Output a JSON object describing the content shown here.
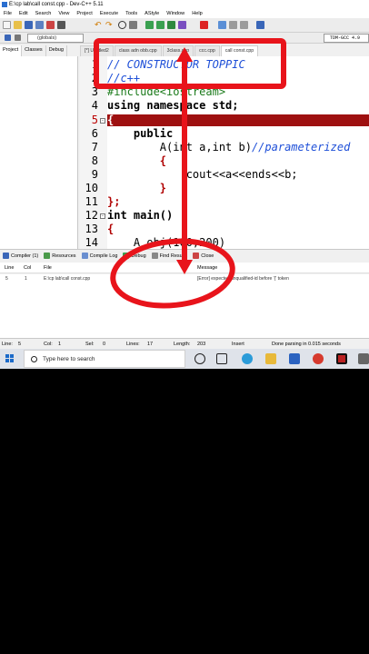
{
  "window": {
    "title": "E:\\cp lab\\call const.cpp - Dev-C++ 5.11"
  },
  "menu": [
    "File",
    "Edit",
    "Search",
    "View",
    "Project",
    "Execute",
    "Tools",
    "AStyle",
    "Window",
    "Help"
  ],
  "toolbar": {
    "scope_combo": "(globals)",
    "compiler_combo": "TDM-GCC 4.9"
  },
  "left_panel": {
    "tabs": [
      "Project",
      "Classes",
      "Debug"
    ]
  },
  "file_tabs": [
    "[*] Untitled2",
    "class adn obb.cpp",
    "3class.cpp",
    "ccc.cpp",
    "call const.cpp"
  ],
  "editor": {
    "lines": [
      {
        "n": "1",
        "text": "// CONSTRUCTOR TOPPIC"
      },
      {
        "n": "2",
        "text": "//c++"
      },
      {
        "n": "3",
        "text": "#include<iostream>"
      },
      {
        "n": "4",
        "text": "using namespace std;"
      },
      {
        "n": "5",
        "text": "{"
      },
      {
        "n": "6",
        "text": "    public"
      },
      {
        "n": "7",
        "text_a": "        A(int a,int b)",
        "text_b": "//parameterized"
      },
      {
        "n": "8",
        "text": "        {"
      },
      {
        "n": "9",
        "text": "            cout<<a<<ends<<b;"
      },
      {
        "n": "10",
        "text": "        }"
      },
      {
        "n": "11",
        "text": "};"
      },
      {
        "n": "12",
        "text": "int main()"
      },
      {
        "n": "13",
        "text": "{"
      },
      {
        "n": "14",
        "text": "    A obj(100,200)"
      }
    ]
  },
  "bottom_tabs": [
    "Compiler (1)",
    "Resources",
    "Compile Log",
    "Debug",
    "Find Results",
    "Close"
  ],
  "messages": {
    "headers": {
      "line": "Line",
      "col": "Col",
      "file": "File",
      "message": "Message"
    },
    "rows": [
      {
        "line": "5",
        "col": "1",
        "file": "E:\\cp lab\\call const.cpp",
        "message": "[Error] expected unqualified-id before '{' token"
      }
    ]
  },
  "status": {
    "line_label": "Line:",
    "line": "5",
    "col_label": "Col:",
    "col": "1",
    "sel_label": "Sel:",
    "sel": "0",
    "lines_label": "Lines:",
    "lines": "17",
    "length_label": "Length:",
    "length": "203",
    "mode": "Insert",
    "parse": "Done parsing in 0.015 seconds"
  },
  "taskbar": {
    "search_placeholder": "Type here to search"
  },
  "colors": {
    "annotation_red": "#e8141b",
    "error_line": "#9e1010",
    "comment_blue": "#1e4fd8"
  }
}
